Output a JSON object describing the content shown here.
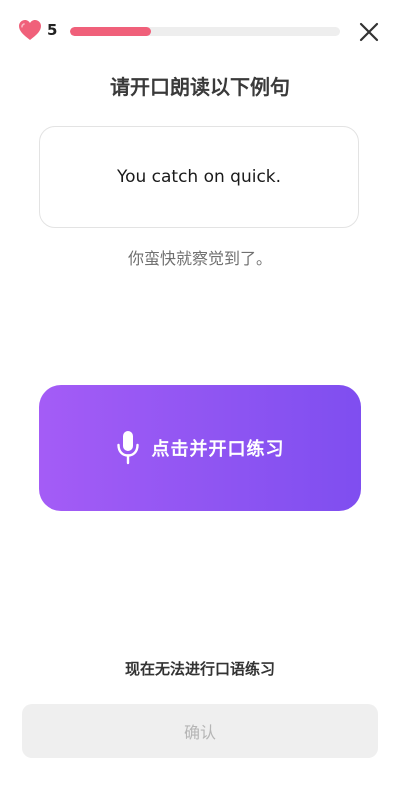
{
  "colors": {
    "heart": "#f0607a",
    "progress_fill": "#f0607a",
    "progress_track": "#eeeeee",
    "speak_button_start": "#a45cf6",
    "speak_button_end": "#7f4ef0",
    "confirm_disabled_bg": "#efefef",
    "confirm_disabled_text": "#b5b5b5"
  },
  "header": {
    "hearts_icon": "heart-icon",
    "hearts_count": "5",
    "progress_fraction": 0.3,
    "close_icon": "close-icon"
  },
  "lesson": {
    "instruction": "请开口朗读以下例句",
    "sentence": "You catch on quick.",
    "translation": "你蛮快就察觉到了。"
  },
  "speak_button": {
    "icon": "microphone-icon",
    "label": "点击并开口练习"
  },
  "footer": {
    "cant_speak_link": "现在无法进行口语练习",
    "confirm_label": "确认"
  }
}
